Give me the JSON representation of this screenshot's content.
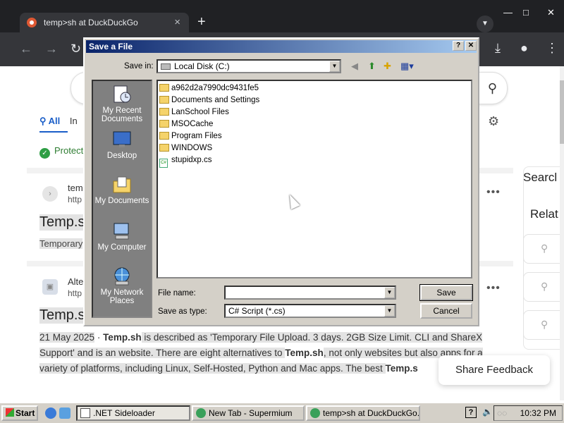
{
  "browser": {
    "tab_title": "temp>sh at DuckDuckGo",
    "tab_close": "×",
    "new_tab": "+",
    "window_buttons": [
      "—",
      "□",
      "✕"
    ]
  },
  "page": {
    "tabs": {
      "all": "All",
      "images_partial": "In"
    },
    "protection": "Protecte",
    "result1": {
      "host": "tem",
      "url": "http",
      "title": "Temp.s",
      "snippet": "Temporary"
    },
    "result2": {
      "host": "Alte",
      "url": "http",
      "title": "Temp.s"
    },
    "snippet": {
      "date": "21 May 2025",
      "sep": " · ",
      "brand1": "Temp.sh",
      "text1": " is described as 'Temporary File Upload. 3 days. 2GB Size Limit. CLI and ShareX Support' and is an website. There are eight alternatives to ",
      "brand2": "Temp.sh",
      "text2": ", not only websites but also apps for a variety of platforms, including Linux, Self-Hosted, Python and Mac apps. The best ",
      "brand3": "Temp.s"
    },
    "sidebar": {
      "search_partial": "Searcl",
      "related_partial": "Relat"
    },
    "share_feedback": "Share Feedback"
  },
  "dialog": {
    "title": "Save a File",
    "help_btn": "?",
    "close_btn": "✕",
    "save_in_label": "Save in:",
    "save_in_value": "Local Disk (C:)",
    "places": [
      {
        "label": "My Recent Documents",
        "icon": "recent-documents-icon"
      },
      {
        "label": "Desktop",
        "icon": "desktop-icon"
      },
      {
        "label": "My Documents",
        "icon": "my-documents-icon"
      },
      {
        "label": "My Computer",
        "icon": "my-computer-icon"
      },
      {
        "label": "My Network Places",
        "icon": "network-places-icon"
      }
    ],
    "files": [
      {
        "name": "a962d2a7990dc9431fe5",
        "type": "folder"
      },
      {
        "name": "Documents and Settings",
        "type": "folder"
      },
      {
        "name": "LanSchool Files",
        "type": "folder"
      },
      {
        "name": "MSOCache",
        "type": "folder"
      },
      {
        "name": "Program Files",
        "type": "folder"
      },
      {
        "name": "WINDOWS",
        "type": "folder"
      },
      {
        "name": "stupidxp.cs",
        "type": "file"
      }
    ],
    "file_name_label": "File name:",
    "file_name_value": "",
    "save_as_type_label": "Save as type:",
    "save_as_type_value": "C# Script (*.cs)",
    "save_button": "Save",
    "cancel_button": "Cancel"
  },
  "taskbar": {
    "start": "Start",
    "tasks": [
      {
        "label": ".NET Sideloader"
      },
      {
        "label": "New Tab - Supermium"
      },
      {
        "label": "temp>sh at DuckDuckGo..."
      }
    ],
    "help": "?",
    "clock": "10:32 PM"
  }
}
